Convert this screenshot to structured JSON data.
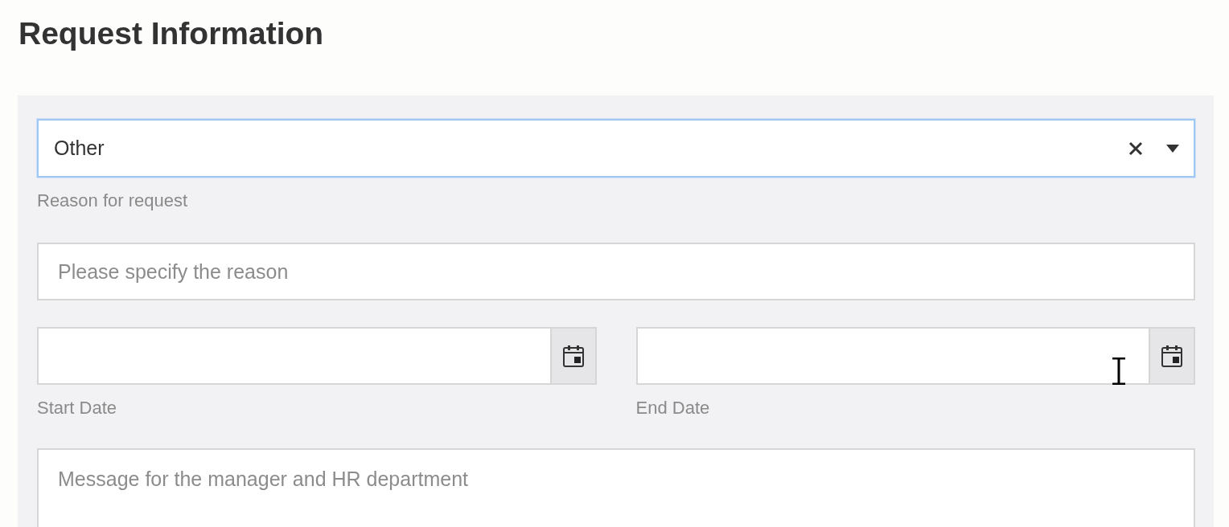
{
  "page": {
    "title": "Request Information"
  },
  "form": {
    "reason_select": {
      "value": "Other",
      "focused": true,
      "label": "Reason for request"
    },
    "reason_field": {
      "placeholder": "Please specify the reason"
    },
    "date_fields": [
      {
        "label": "Start Date"
      },
      {
        "label": "End Date"
      }
    ],
    "message_field": {
      "placeholder": "Message for the manager and HR department"
    }
  }
}
